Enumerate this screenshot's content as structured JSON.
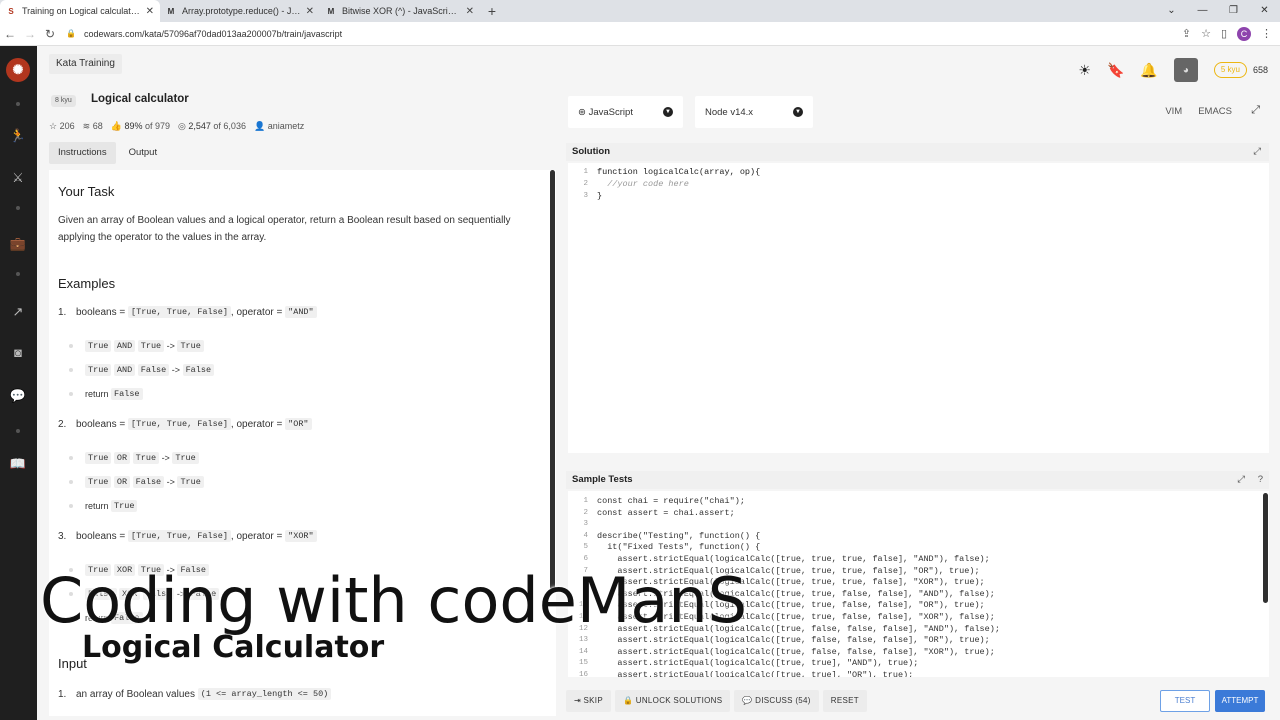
{
  "browser": {
    "tabs": [
      {
        "title": "Training on Logical calculator | C",
        "favicon": "S",
        "active": true
      },
      {
        "title": "Array.prototype.reduce() - JavaSc",
        "favicon": "M",
        "active": false
      },
      {
        "title": "Bitwise XOR (^) - JavaScript | MC",
        "favicon": "M",
        "active": false
      }
    ],
    "new_tab": "+",
    "url": "codewars.com/kata/57096af70dad013aa200007b/train/javascript",
    "profile_initial": "C"
  },
  "header": {
    "kata_training": "Kata Training",
    "rank_badge": "5 kyu",
    "honor": "658"
  },
  "kata": {
    "kyu": "8 kyu",
    "title": "Logical calculator",
    "stars": "206",
    "collections": "68",
    "satisfaction": "89%",
    "satisfaction_of": "of 979",
    "completed": "2,547",
    "completed_of": "of 6,036",
    "author": "aniametz"
  },
  "panel_tabs": {
    "instructions": "Instructions",
    "output": "Output"
  },
  "description": {
    "your_task": "Your Task",
    "task_text": "Given an array of Boolean values and a logical operator, return a Boolean result based on sequentially applying the operator to the values in the array.",
    "examples": "Examples",
    "ex1_num": "1.",
    "ex2_num": "2.",
    "ex3_num": "3.",
    "booleans": "booleans =",
    "booleans_val": "[True, True, False]",
    "operator": ", operator =",
    "op_and": "\"AND\"",
    "op_or": "\"OR\"",
    "op_xor": "\"XOR\"",
    "and_lines": [
      [
        "True",
        "AND",
        "True",
        "->",
        "True"
      ],
      [
        "True",
        "AND",
        "False",
        "->",
        "False"
      ]
    ],
    "or_lines": [
      [
        "True",
        "OR",
        "True",
        "->",
        "True"
      ],
      [
        "True",
        "OR",
        "False",
        "->",
        "True"
      ]
    ],
    "xor_lines": [
      [
        "True",
        "XOR",
        "True",
        "->",
        "False"
      ],
      [
        "False",
        "XOR",
        "False",
        "->",
        "False"
      ]
    ],
    "return_word": "return",
    "ret_false": "False",
    "ret_true": "True",
    "input": "Input",
    "input_item_num": "1.",
    "input_item": "an array of Boolean values",
    "input_item_code": "(1 <= array_length <= 50)"
  },
  "editor_bar": {
    "language": "JavaScript",
    "runtime": "Node v14.x",
    "vim": "VIM",
    "emacs": "EMACS"
  },
  "solution": {
    "title": "Solution",
    "lines": [
      "function logicalCalc(array, op){",
      "  //your code here",
      "}"
    ]
  },
  "tests": {
    "title": "Sample Tests",
    "lines": [
      "const chai = require(\"chai\");",
      "const assert = chai.assert;",
      "",
      "describe(\"Testing\", function() {",
      "  it(\"Fixed Tests\", function() {",
      "    assert.strictEqual(logicalCalc([true, true, true, false], \"AND\"), false);",
      "    assert.strictEqual(logicalCalc([true, true, true, false], \"OR\"), true);",
      "    assert.strictEqual(logicalCalc([true, true, true, false], \"XOR\"), true);",
      "    assert.strictEqual(logicalCalc([true, true, false, false], \"AND\"), false);",
      "    assert.strictEqual(logicalCalc([true, true, false, false], \"OR\"), true);",
      "    assert.strictEqual(logicalCalc([true, true, false, false], \"XOR\"), false);",
      "    assert.strictEqual(logicalCalc([true, false, false, false], \"AND\"), false);",
      "    assert.strictEqual(logicalCalc([true, false, false, false], \"OR\"), true);",
      "    assert.strictEqual(logicalCalc([true, false, false, false], \"XOR\"), true);",
      "    assert.strictEqual(logicalCalc([true, true], \"AND\"), true);",
      "    assert.strictEqual(logicalCalc([true, true], \"OR\"), true);"
    ]
  },
  "actions": {
    "skip": "SKIP",
    "unlock": "UNLOCK SOLUTIONS",
    "discuss": "DISCUSS (54)",
    "reset": "RESET",
    "test": "TEST",
    "attempt": "ATTEMPT"
  },
  "overlay": {
    "line1": "Coding with codeManS",
    "line2": "Logical Calculator"
  },
  "colors": {
    "brand": "#b1361e",
    "sidebar": "#1f1f1f",
    "rank": "#ecb613",
    "attempt": "#3b7ad8"
  }
}
